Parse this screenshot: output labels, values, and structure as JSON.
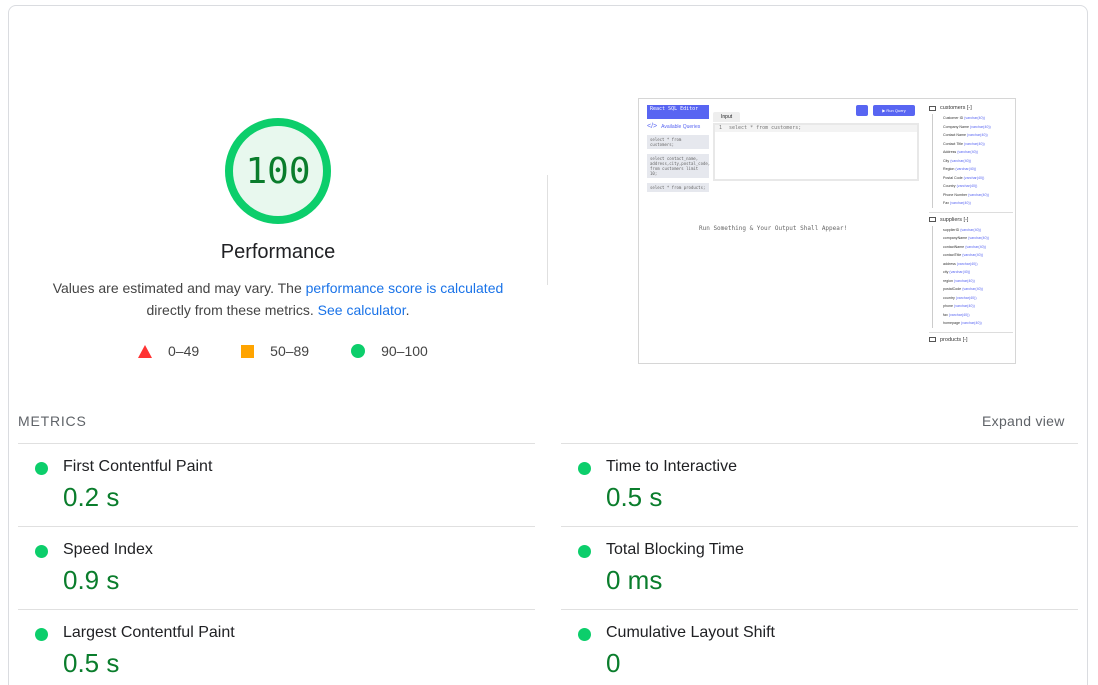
{
  "gauge": {
    "score": "100",
    "score_fraction": 1.0,
    "title": "Performance",
    "desc_prefix": "Values are estimated and may vary. The ",
    "desc_link1": "performance score is calculated",
    "desc_middle": " directly from these metrics. ",
    "desc_link2": "See calculator",
    "desc_suffix": ".",
    "color_ring": "#0cce6b",
    "color_fill": "#e8f8ee",
    "color_text": "#0a7d2c"
  },
  "legend": [
    {
      "range": "0–49",
      "shape": "triangle",
      "color": "#ff3333"
    },
    {
      "range": "50–89",
      "shape": "square",
      "color": "#ffa400"
    },
    {
      "range": "90–100",
      "shape": "circle",
      "color": "#0cce6b"
    }
  ],
  "thumbnail": {
    "brand": "React SQL Editor",
    "available_queries": "Available Queries",
    "queries": [
      "select * from customers;",
      "select contact_name, address,city,postal_code, from customers limit 10;",
      "select * from products;"
    ],
    "tab": "Input",
    "run_button": "Run Query",
    "editor_line_number": "1",
    "editor_text": "select * from customers;",
    "output_text": "Run Something & Your Output Shall Appear!",
    "tables": [
      {
        "name": "customers [-]",
        "columns": [
          {
            "name": "Customer ID",
            "type": "(varchar(40))"
          },
          {
            "name": "Company Name",
            "type": "(varchar(40))"
          },
          {
            "name": "Contact Name",
            "type": "(varchar(40))"
          },
          {
            "name": "Contact Title",
            "type": "(varchar(40))"
          },
          {
            "name": "Address",
            "type": "(varchar(40))"
          },
          {
            "name": "City",
            "type": "(varchar(40))"
          },
          {
            "name": "Region",
            "type": "(varchar(40))"
          },
          {
            "name": "Postal Code",
            "type": "(varchar(40))"
          },
          {
            "name": "Country",
            "type": "(varchar(40))"
          },
          {
            "name": "Phone Number",
            "type": "(varchar(40))"
          },
          {
            "name": "Fax",
            "type": "(varchar(40))"
          }
        ]
      },
      {
        "name": "suppliers [-]",
        "columns": [
          {
            "name": "supplierID",
            "type": "(varchar(40))"
          },
          {
            "name": "companyName",
            "type": "(varchar(40))"
          },
          {
            "name": "contactName",
            "type": "(varchar(40))"
          },
          {
            "name": "contactTitle",
            "type": "(varchar(40))"
          },
          {
            "name": "address",
            "type": "(varchar(40))"
          },
          {
            "name": "city",
            "type": "(varchar(40))"
          },
          {
            "name": "region",
            "type": "(varchar(40))"
          },
          {
            "name": "postalCode",
            "type": "(varchar(40))"
          },
          {
            "name": "country",
            "type": "(varchar(40))"
          },
          {
            "name": "phone",
            "type": "(varchar(40))"
          },
          {
            "name": "fax",
            "type": "(varchar(40))"
          },
          {
            "name": "homepage",
            "type": "(varchar(40))"
          }
        ]
      },
      {
        "name": "products [-]",
        "columns": []
      }
    ]
  },
  "metrics": {
    "label": "METRICS",
    "expand": "Expand view",
    "left": [
      {
        "name": "First Contentful Paint",
        "value": "0.2 s"
      },
      {
        "name": "Speed Index",
        "value": "0.9 s"
      },
      {
        "name": "Largest Contentful Paint",
        "value": "0.5 s"
      }
    ],
    "right": [
      {
        "name": "Time to Interactive",
        "value": "0.5 s"
      },
      {
        "name": "Total Blocking Time",
        "value": "0 ms"
      },
      {
        "name": "Cumulative Layout Shift",
        "value": "0"
      }
    ]
  }
}
